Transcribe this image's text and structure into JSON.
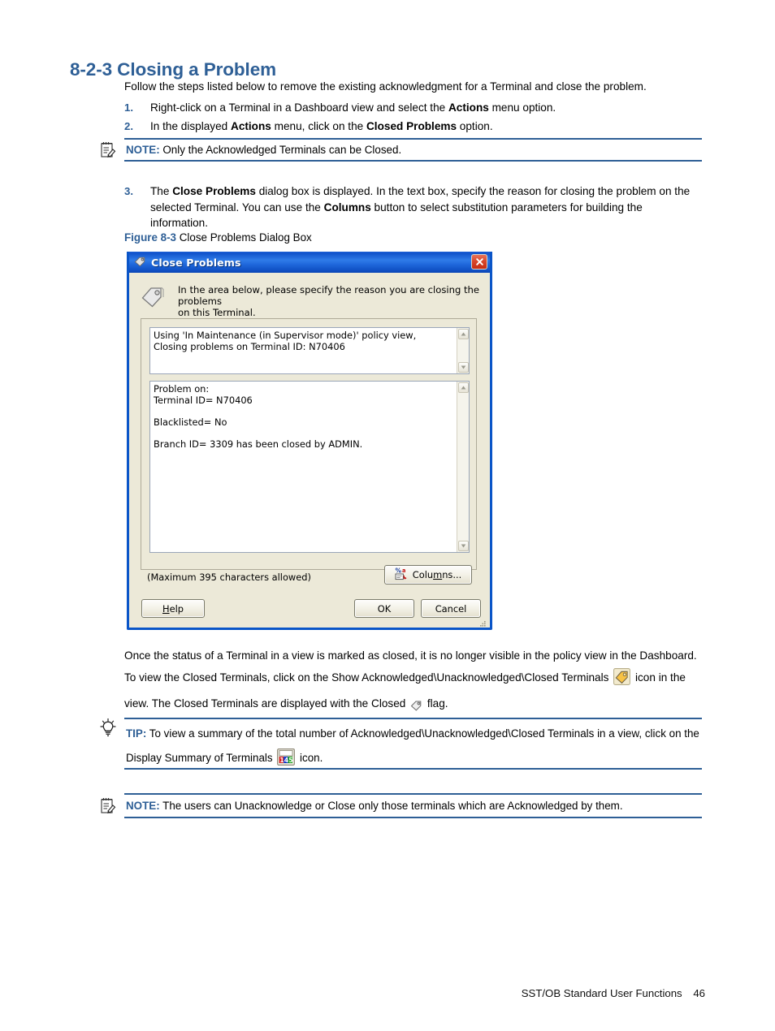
{
  "heading": "8-2-3 Closing a Problem",
  "intro": "Follow the steps listed below to remove the existing acknowledgment for a Terminal and close the problem.",
  "steps": [
    {
      "num": "1.",
      "parts": [
        {
          "t": "Right-click on a Terminal in a Dashboard view and select the ",
          "b": false
        },
        {
          "t": "Actions",
          "b": true
        },
        {
          "t": " menu option.",
          "b": false
        }
      ]
    },
    {
      "num": "2.",
      "parts": [
        {
          "t": "In the displayed ",
          "b": false
        },
        {
          "t": "Actions",
          "b": true
        },
        {
          "t": " menu, click on the ",
          "b": false
        },
        {
          "t": "Closed Problems",
          "b": true
        },
        {
          "t": " option.",
          "b": false
        }
      ]
    },
    {
      "num": "3.",
      "parts": [
        {
          "t": "The ",
          "b": false
        },
        {
          "t": "Close Problems",
          "b": true
        },
        {
          "t": " dialog box is displayed.  In the text box, specify the reason for closing the problem on the selected Terminal.  You can use the ",
          "b": false
        },
        {
          "t": "Columns",
          "b": true
        },
        {
          "t": " button to select substitution parameters for building the information.",
          "b": false
        }
      ]
    }
  ],
  "note1": {
    "label": "NOTE:",
    "text": "Only the Acknowledged Terminals can be Closed.",
    "icon": "note-pad-pencil-icon"
  },
  "figure": {
    "label": "Figure 8-3",
    "caption": "Close Problems Dialog Box"
  },
  "dialog": {
    "title": "Close Problems",
    "title_icon": "tag-icon",
    "close_icon": "close-icon",
    "header_line1": "In the area below, please specify the reason you are closing the problems",
    "header_line2": "on this Terminal.",
    "header_icon": "tag-icon",
    "reason_box": {
      "line1": "Using 'In Maintenance (in Supervisor mode)' policy view,",
      "line2": "Closing problems on Terminal ID: N70406"
    },
    "problem_box": {
      "line1": "Problem on:",
      "line2": "Terminal ID= N70406",
      "line3": "Blacklisted= No",
      "line4": "Branch ID= 3309 has been closed by ADMIN."
    },
    "max_chars_note": "(Maximum 395 characters allowed)",
    "buttons": {
      "columns": "Columns...",
      "columns_accel": "m",
      "help": "Help",
      "help_accel": "H",
      "ok": "OK",
      "cancel": "Cancel"
    },
    "colors": {
      "titlebar_blue": "#1153CB",
      "border_blue": "#0A55C8",
      "face": "#ECE9D8",
      "close_red": "#C62D12"
    }
  },
  "after_paragraph": {
    "p1": "Once the status of a Terminal in a view is marked as closed, it is no longer visible in the policy view in the Dashboard.  To view the Closed Terminals, click on the Show Acknowledged\\Unacknowledged\\Closed Terminals ",
    "p2": " icon in the view.  The Closed Terminals are displayed with the Closed ",
    "p3": " flag.",
    "icon1": "show-acknowledged-terminals-icon",
    "icon2": "closed-flag-tag-icon"
  },
  "tip": {
    "label": "TIP:",
    "icon": "lightbulb-icon",
    "t1": "To view a summary of the total number of Acknowledged\\Unacknowledged\\Closed Terminals in a view, click on the Display Summary of Terminals ",
    "t2": " icon.",
    "inline_icon": "display-summary-of-terminals-icon",
    "inline_icon_digits": "145"
  },
  "note2": {
    "label": "NOTE:",
    "text": "The users can Unacknowledge or Close only those terminals which are Acknowledged by them.",
    "icon": "note-pad-pencil-icon"
  },
  "footer": {
    "doc_title": "SST/OB Standard User Functions",
    "page_number": "46"
  }
}
